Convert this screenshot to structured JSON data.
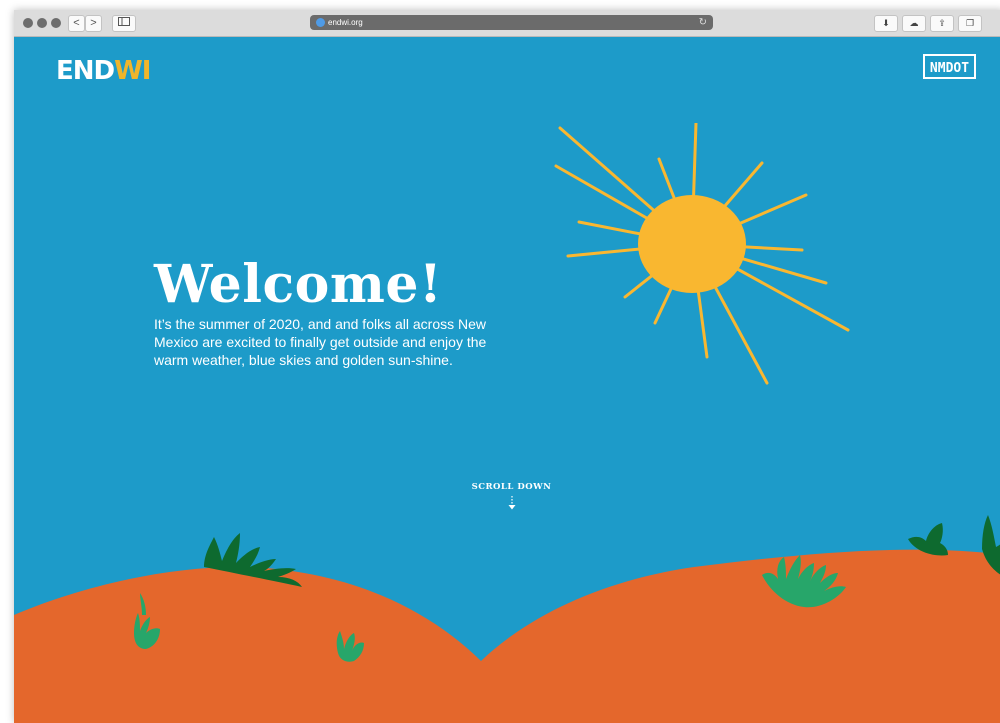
{
  "browser": {
    "url": "endwi.org",
    "back_label": "<",
    "forward_label": ">"
  },
  "header": {
    "logo_part1": "END",
    "logo_part2": "WI",
    "partner_label": "NMDOT"
  },
  "hero": {
    "title": "Welcome!",
    "paragraph": "It’s the summer of 2020, and and folks all across New Mexico are excited to finally get outside and enjoy the warm weather, blue skies and golden sun-shine."
  },
  "scroll": {
    "label": "SCROLL DOWN"
  },
  "colors": {
    "sky": "#1d9bc9",
    "sun": "#f9b730",
    "ground": "#e4672c",
    "plant_dark": "#0e6a2f",
    "plant_light": "#27a66a",
    "logo_accent": "#f0b52b"
  }
}
